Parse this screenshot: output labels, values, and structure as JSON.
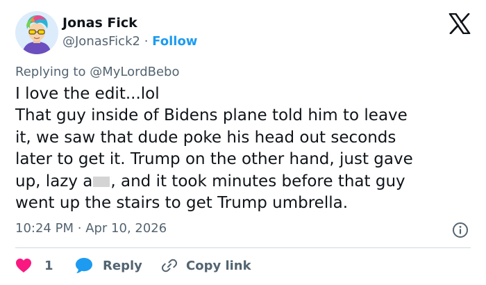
{
  "author": {
    "name": "Jonas Fick",
    "handle": "@JonasFick2",
    "separator": "·",
    "follow_label": "Follow"
  },
  "brand": {
    "logo_icon": "x-logo-icon"
  },
  "reply_context": {
    "prefix": "Replying to",
    "mention": "@MyLordBebo"
  },
  "tweet": {
    "lines": [
      "I love the edit...lol",
      "That guy inside of Bidens plane told him to leave",
      "it, we saw that dude poke his head out seconds",
      "later to get it. Trump on the other hand, just gave"
    ],
    "line5_before": "up, lazy a",
    "line5_after": ", and it took minutes before that guy",
    "line6": "went up the stairs to get Trump umbrella."
  },
  "meta": {
    "time": "10:24 PM",
    "separator": "·",
    "date": "Apr 10, 2026",
    "info_icon": "info-icon"
  },
  "actions": {
    "like_count": "1",
    "reply_label": "Reply",
    "copy_label": "Copy link"
  },
  "colors": {
    "accent": "#1d9bf0",
    "like": "#f91880",
    "muted": "#536471",
    "text": "#0f1419"
  }
}
